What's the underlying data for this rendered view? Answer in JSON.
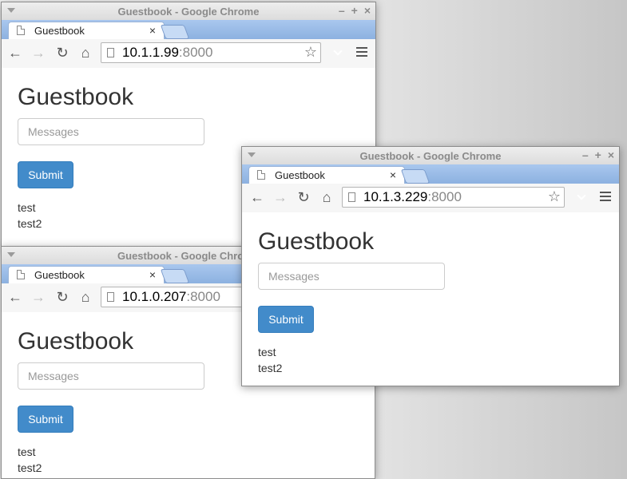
{
  "windows": [
    {
      "title": "Guestbook - Google Chrome",
      "tab_label": "Guestbook",
      "url_host": "10.1.1.99",
      "url_port": ":8000",
      "heading": "Guestbook",
      "input_placeholder": "Messages",
      "submit_label": "Submit",
      "entries": [
        "test",
        "test2"
      ]
    },
    {
      "title": "Guestbook - Google Chrome",
      "tab_label": "Guestbook",
      "url_host": "10.1.0.207",
      "url_port": ":8000",
      "heading": "Guestbook",
      "input_placeholder": "Messages",
      "submit_label": "Submit",
      "entries": [
        "test",
        "test2"
      ]
    },
    {
      "title": "Guestbook - Google Chrome",
      "tab_label": "Guestbook",
      "url_host": "10.1.3.229",
      "url_port": ":8000",
      "heading": "Guestbook",
      "input_placeholder": "Messages",
      "submit_label": "Submit",
      "entries": [
        "test",
        "test2"
      ]
    }
  ],
  "icons": {
    "back": "back-arrow-icon",
    "forward": "forward-arrow-icon",
    "reload": "reload-icon",
    "home": "home-icon",
    "page": "page-icon",
    "bookmark": "star-icon",
    "pocket": "pocket-icon",
    "menu": "hamburger-menu-icon",
    "close_tab": "close-icon"
  },
  "colors": {
    "button": "#428bca",
    "tabstrip": "#9fc0ea"
  }
}
